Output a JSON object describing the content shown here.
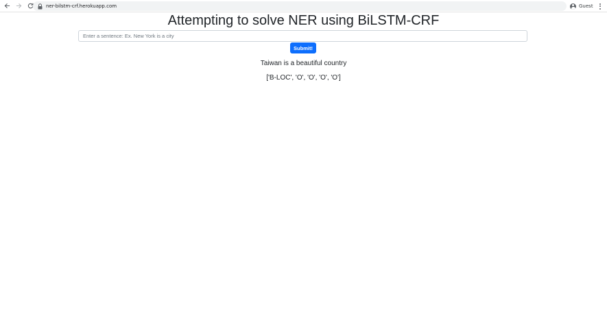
{
  "browser": {
    "url": "ner-bilstm-crf.herokuapp.com",
    "profile_label": "Guest",
    "icons": {
      "back": "arrow-left-icon",
      "forward": "arrow-right-icon",
      "reload": "reload-icon",
      "lock": "lock-icon",
      "profile": "person-avatar-icon",
      "menu": "kebab-menu-icon"
    }
  },
  "page": {
    "title": "Attempting to solve NER using BiLSTM-CRF",
    "input": {
      "value": "",
      "placeholder": "Enter a sentence: Ex. New York is a city"
    },
    "submit_label": "Submit!",
    "result": {
      "sentence": "Taiwan is a beautiful country",
      "tags": "['B-LOC', 'O', 'O', 'O', 'O']"
    }
  },
  "colors": {
    "primary_button": "#0d6efd",
    "text": "#212529",
    "input_border": "#ced4da",
    "omnibox_bg": "#f1f3f4"
  }
}
